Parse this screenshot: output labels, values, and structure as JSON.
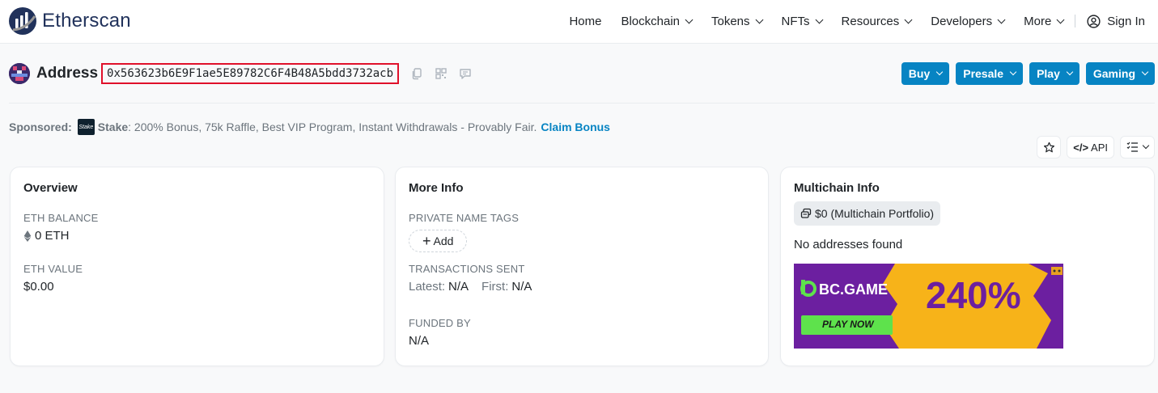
{
  "brand": {
    "name": "Etherscan"
  },
  "nav": {
    "items": [
      {
        "label": "Home",
        "dropdown": false
      },
      {
        "label": "Blockchain",
        "dropdown": true
      },
      {
        "label": "Tokens",
        "dropdown": true
      },
      {
        "label": "NFTs",
        "dropdown": true
      },
      {
        "label": "Resources",
        "dropdown": true
      },
      {
        "label": "Developers",
        "dropdown": true
      },
      {
        "label": "More",
        "dropdown": true
      }
    ],
    "sign_in": "Sign In"
  },
  "address": {
    "label": "Address",
    "value": "0x563623b6E9F1ae5E89782C6F4B48A5bdd3732acb",
    "highlight_color": "#e0102a"
  },
  "action_buttons": [
    "Buy",
    "Presale",
    "Play",
    "Gaming"
  ],
  "sponsored": {
    "prefix": "Sponsored:",
    "logo_text": "Stake",
    "name": "Stake",
    "text": ": 200% Bonus, 75k Raffle, Best VIP Program, Instant Withdrawals - Provably Fair.",
    "cta": "Claim Bonus"
  },
  "tools": {
    "api_label": "API"
  },
  "overview": {
    "title": "Overview",
    "eth_balance_label": "ETH BALANCE",
    "eth_balance": "0 ETH",
    "eth_value_label": "ETH VALUE",
    "eth_value": "$0.00"
  },
  "more_info": {
    "title": "More Info",
    "private_tags_label": "PRIVATE NAME TAGS",
    "add_label": "Add",
    "tx_sent_label": "TRANSACTIONS SENT",
    "latest_label": "Latest:",
    "latest_value": "N/A",
    "first_label": "First:",
    "first_value": "N/A",
    "funded_by_label": "FUNDED BY",
    "funded_by_value": "N/A"
  },
  "multichain": {
    "title": "Multichain Info",
    "portfolio": "$0 (Multichain Portfolio)",
    "empty_text": "No addresses found",
    "ad": {
      "brand": "BC.GAME",
      "percent": "240%",
      "cta": "PLAY NOW"
    }
  },
  "colors": {
    "accent": "#0784c3",
    "brand_dark": "#21325b",
    "ad_purple": "#6c1fa0",
    "ad_orange": "#f7b319",
    "ad_green": "#5ee24c"
  }
}
